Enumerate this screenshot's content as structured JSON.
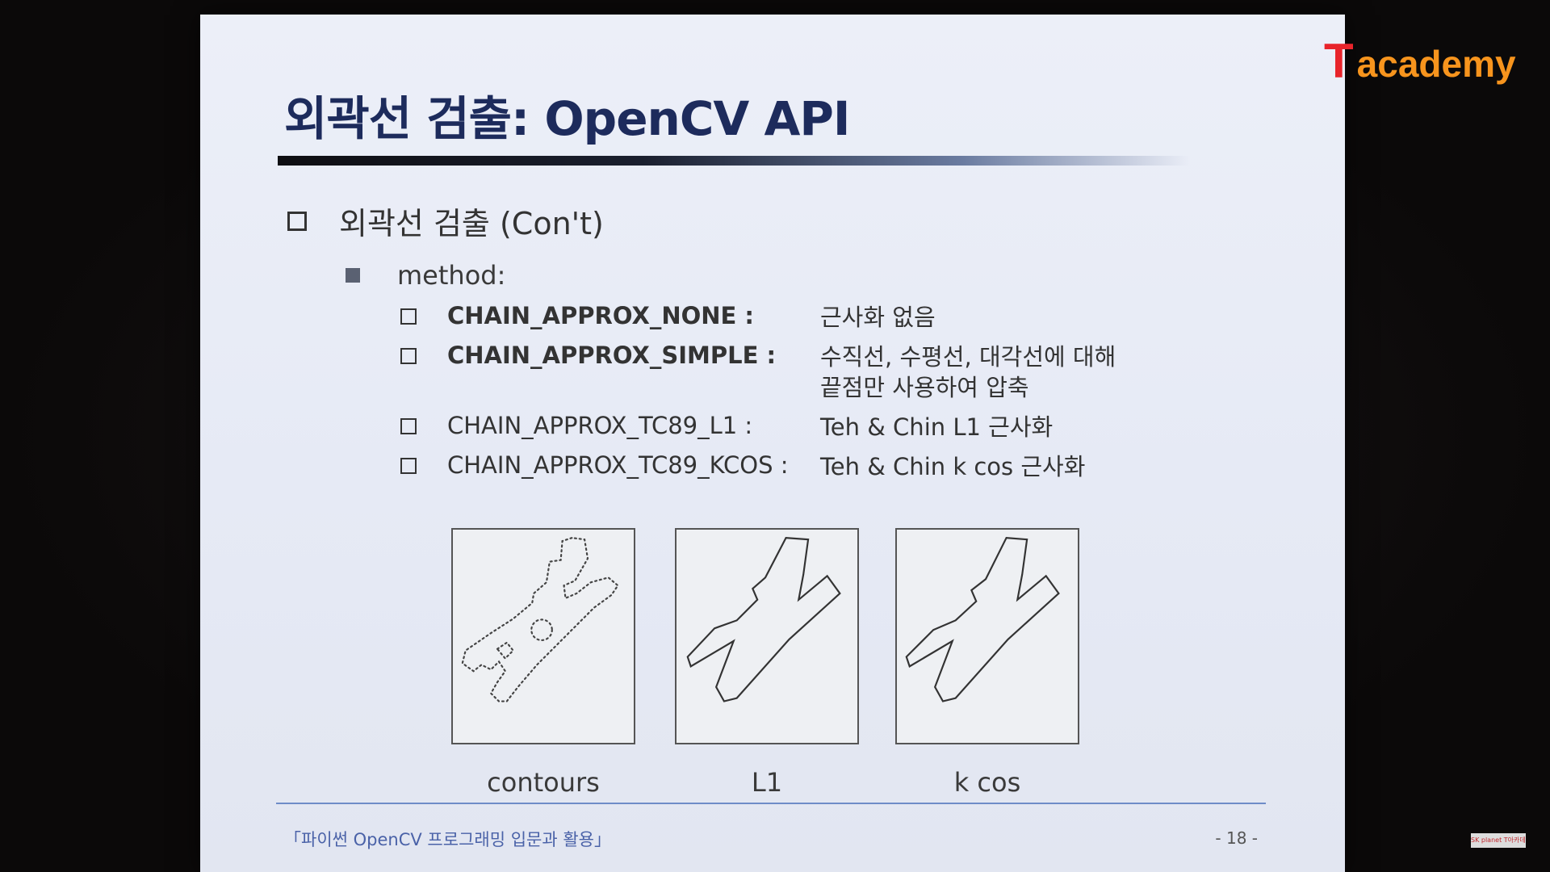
{
  "logo": {
    "t": "T",
    "rest": "academy"
  },
  "slide": {
    "title": "외곽선 검출: OpenCV API",
    "level1": "외곽선 검출 (Con't)",
    "level2": "method:",
    "items": [
      {
        "name": "CHAIN_APPROX_NONE :",
        "desc": "근사화 없음"
      },
      {
        "name": "CHAIN_APPROX_SIMPLE :",
        "desc": "수직선, 수평선, 대각선에 대해",
        "desc2": "끝점만 사용하여 압축"
      },
      {
        "name": "CHAIN_APPROX_TC89_L1 :",
        "desc": "Teh & Chin L1 근사화"
      },
      {
        "name": "CHAIN_APPROX_TC89_KCOS :",
        "desc": "Teh & Chin k cos 근사화"
      }
    ],
    "figures": [
      {
        "label": "contours"
      },
      {
        "label": "L1"
      },
      {
        "label": "k cos"
      }
    ],
    "footer_left": "「파이썬 OpenCV 프로그래밍 입문과 활용」",
    "footer_right": "- 18 -"
  },
  "corner_badge": "SK planet T아카데미"
}
